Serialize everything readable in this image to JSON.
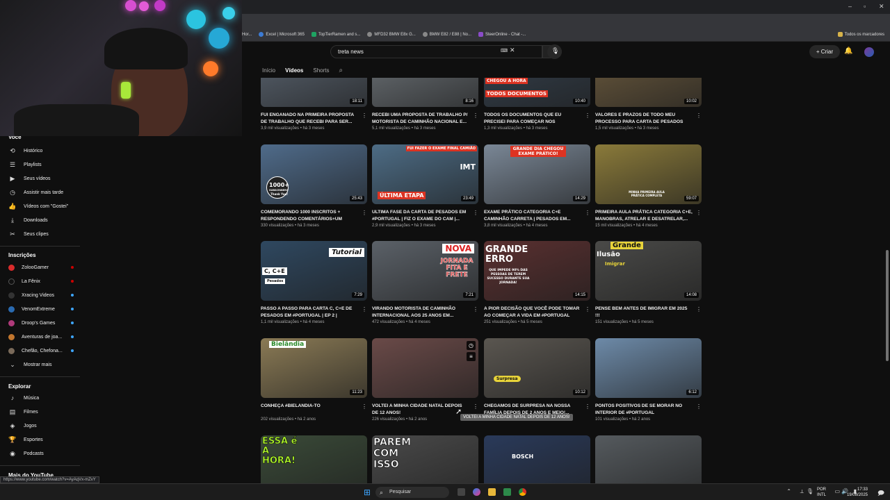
{
  "browser": {
    "bookmarks": [
      "Hor...",
      "Excel | Microsoft 365",
      "TopTierRamen and s...",
      "MFD32 BMW E8x G...",
      "BMW E82 / E88 | No...",
      "SteerOnline - Chat -..."
    ],
    "bookmarks_right": "Todos os marcadores",
    "status_url": "https://www.youtube.com/watch?v=AyAqVx-mZvY"
  },
  "header": {
    "search_value": "treta news",
    "create_label": "Criar"
  },
  "channel_tabs": [
    "Início",
    "Vídeos",
    "Shorts"
  ],
  "sidebar": {
    "you_heading": "Você",
    "you_items": [
      "Histórico",
      "Playlists",
      "Seus vídeos",
      "Assistir mais tarde",
      "Vídeos com \"Gostei\"",
      "Downloads",
      "Seus clipes"
    ],
    "subs_heading": "Inscrições",
    "subs": [
      "ZolooGamer",
      "La Fênix",
      "Xracing Videos",
      "VenomExtreme",
      "Droop's Games",
      "Aventuras de joa...",
      "Chefão, Chefona...",
      "Mostrar mais"
    ],
    "explore_heading": "Explorar",
    "explore": [
      "Música",
      "Filmes",
      "Jogos",
      "Esportes",
      "Podcasts"
    ],
    "more_heading": "Mais do YouTube"
  },
  "videos": [
    {
      "title": "FUI ENGANADO NA PRIMEIRA PROPOSTA DE TRABALHO QUE RECEBI PARA SER...",
      "meta": "3,9 mil visualizações • há 3 meses",
      "duration": "18:11",
      "color": "#5a6470"
    },
    {
      "title": "RECEBI UMA PROPOSTA DE TRABALHO P/ MOTORISTA DE CAMINHÃO NACIONAL E...",
      "meta": "5,1 mil visualizações • há 3 meses",
      "duration": "8:16",
      "color": "#6d7378"
    },
    {
      "title": "TODOS OS DOCUMENTOS QUE EU PRECISEI PARA COMEÇAR NOS CAMINHÕES EM...",
      "meta": "1,3 mil visualizações • há 3 meses",
      "duration": "10:40",
      "color": "#35414e"
    },
    {
      "title": "VALORES E PRAZOS DE TODO MEU PROCESSO PARA CARTA DE PESADOS EM...",
      "meta": "1,5 mil visualizações • há 3 meses",
      "duration": "10:02",
      "color": "#6b5a3e"
    },
    {
      "title": "COMEMORANDO 1000 INSCRITOS + RESPONDENDO COMENTÁRIOS+UM POUC...",
      "meta": "330 visualizações • há 3 meses",
      "duration": "25:43",
      "color": "#4f6b8a"
    },
    {
      "title": "ULTIMA FASE DA CARTA DE PESADOS EM #portugal | FIZ O EXAME DO CAM |...",
      "meta": "2,9 mil visualizações • há 3 meses",
      "duration": "23:49",
      "color": "#4d6c85"
    },
    {
      "title": "EXAME PRÁTICO CATEGORIA C+E CAMINHÃO CARRETA | PESADOS EM...",
      "meta": "3,8 mil visualizações • há 4 meses",
      "duration": "14:29",
      "color": "#7a8796"
    },
    {
      "title": "PRIMEIRA AULA PRÁTICA CATEGORIA C+E, MANOBRAS, ATRELAR E DESATRELAR,...",
      "meta": "15 mil visualizações • há 4 meses",
      "duration": "59:07",
      "color": "#8a7a3a"
    },
    {
      "title": "PASSO A PASSO PARA CARTA C, C+E DE PESADOS EM #portugal | EP 2 |",
      "meta": "1,1 mil visualizações • há 4 meses",
      "duration": "7:29",
      "color": "#2f4860"
    },
    {
      "title": "VIRANDO MOTORISTA DE CAMINHÃO INTERNACIONAL AOS 25 ANOS EM...",
      "meta": "472 visualizações • há 4 meses",
      "duration": "7:21",
      "color": "#5b6168"
    },
    {
      "title": "A PIOR DECISÃO QUE VOCÊ PODE TOMAR AO COMEÇAR A VIDA EM #portugal",
      "meta": "251 visualizações • há 5 meses",
      "duration": "14:15",
      "color": "#5a3030"
    },
    {
      "title": "PENSE BEM ANTES DE IMIGRAR EM 2025 !!!",
      "meta": "151 visualizações • há 5 meses",
      "duration": "14:08",
      "color": "#4a4a48"
    },
    {
      "title": "CONHEÇA #BIELANDIA-TO",
      "meta": "202 visualizações • há 2 anos",
      "duration": "11:23",
      "color": "#8a7a55"
    },
    {
      "title": "VOLTEI A MINHA CIDADE NATAL DEPOIS DE 12 ANOS!",
      "meta": "226 visualizações • há 2 anos",
      "duration": "",
      "color": "#6a4a48"
    },
    {
      "title": "CHEGAMOS DE SURPRESA NA NOSSA FAMÍLIA DEPOIS DE 2 ANOS E MEIO!...",
      "meta": "",
      "duration": "10:12",
      "color": "#5a5650"
    },
    {
      "title": "PONTOS POSITIVOS DE SE MORAR NO INTERIOR DE #portugal",
      "meta": "101 visualizações • há 2 anos",
      "duration": "6:12",
      "color": "#6d8aa8"
    },
    {
      "title": "",
      "meta": "",
      "duration": "",
      "color": "#3a4a38"
    },
    {
      "title": "",
      "meta": "",
      "duration": "",
      "color": "#4a4a4a"
    },
    {
      "title": "",
      "meta": "",
      "duration": "",
      "color": "#2a3a5a"
    },
    {
      "title": "",
      "meta": "",
      "duration": "",
      "color": "#555a5e"
    }
  ],
  "thumb_text": {
    "t2": "CHEGOU A HORA",
    "t2b": "TODOS DOCUMENTOS",
    "t4a": "1000+",
    "t4b": "SUBSCRIBERS",
    "t4c": "Thank You!",
    "t5a": "FUI FAZER O EXAME FINAL CAMIÃO",
    "t5b": "IMT",
    "t5c": "ÚLTIMA ETAPA",
    "t6": "GRANDE DIA CHEGOU EXAME PRÁTICO!",
    "t7": "MINHA PRIMEIRA AULA PRÁTICA COMPLETA",
    "t8a": "Tutorial",
    "t8b": "C, C+E",
    "t8c": "Pesados",
    "t9a": "NOVA",
    "t9b": "JORNADA FITA E FRETE",
    "t10a": "GRANDE ERRO",
    "t10b": "QUE IMPEDE 90% DAS PESSOAS DE TEREM SUCESSO DURANTE SUA JORNADA!",
    "t11a": "Grande",
    "t11b": "Ilusão",
    "t11c": "Imigrar",
    "t12": "Bielândia",
    "t14": "Surpresa",
    "t16": "ESSA é A HORA!",
    "t17": "PAREM COM ISSO",
    "t18": "BOSCH"
  },
  "tooltip": "VOLTEI A MINHA CIDADE NATAL DEPOIS DE 12 ANOS!",
  "taskbar": {
    "search_placeholder": "Pesquisar",
    "lang1": "POR",
    "lang2": "INTL",
    "time": "17:33",
    "date": "19/08/2025"
  }
}
